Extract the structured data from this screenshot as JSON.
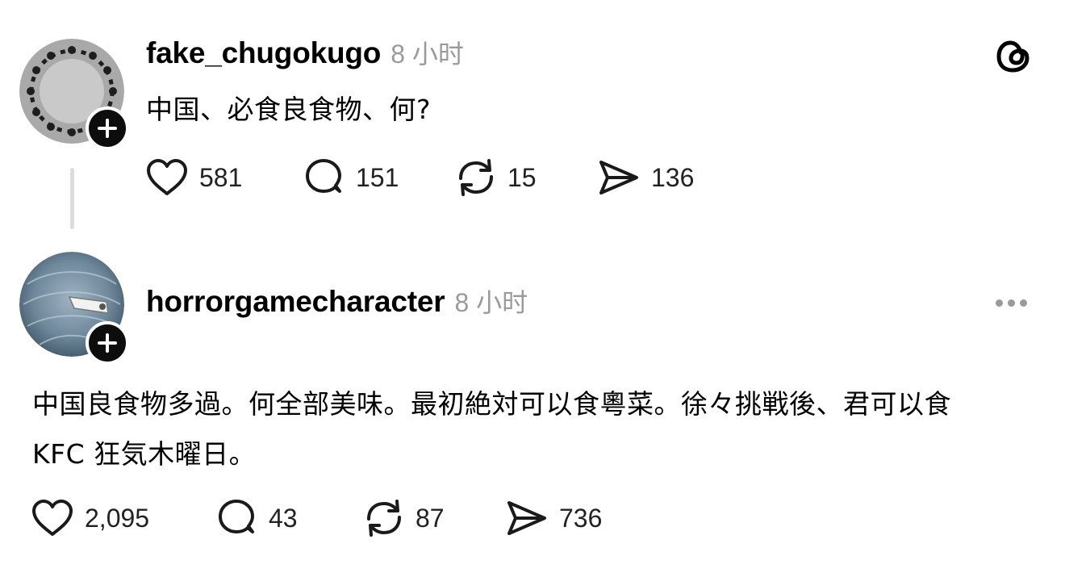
{
  "app": {
    "logo_icon": "threads-logo-icon"
  },
  "posts": [
    {
      "username": "fake_chugokugo",
      "timestamp": "8 小时",
      "text": "中国、必食良食物、何?",
      "actions": {
        "likes": "581",
        "replies": "151",
        "reposts": "15",
        "shares": "136"
      }
    },
    {
      "username": "horrorgamecharacter",
      "timestamp": "8 小时",
      "text_line1": "中国良食物多過。何全部美味。最初絶対可以食粵菜。徐々挑戦後、君可以食",
      "text_line2": "KFC 狂気木曜日。",
      "actions": {
        "likes": "2,095",
        "replies": "43",
        "reposts": "87",
        "shares": "736"
      }
    }
  ],
  "colors": {
    "text": "#000000",
    "muted": "#9a9a9a",
    "thread_line": "#dcdcdc",
    "badge": "#0d0d0d"
  }
}
